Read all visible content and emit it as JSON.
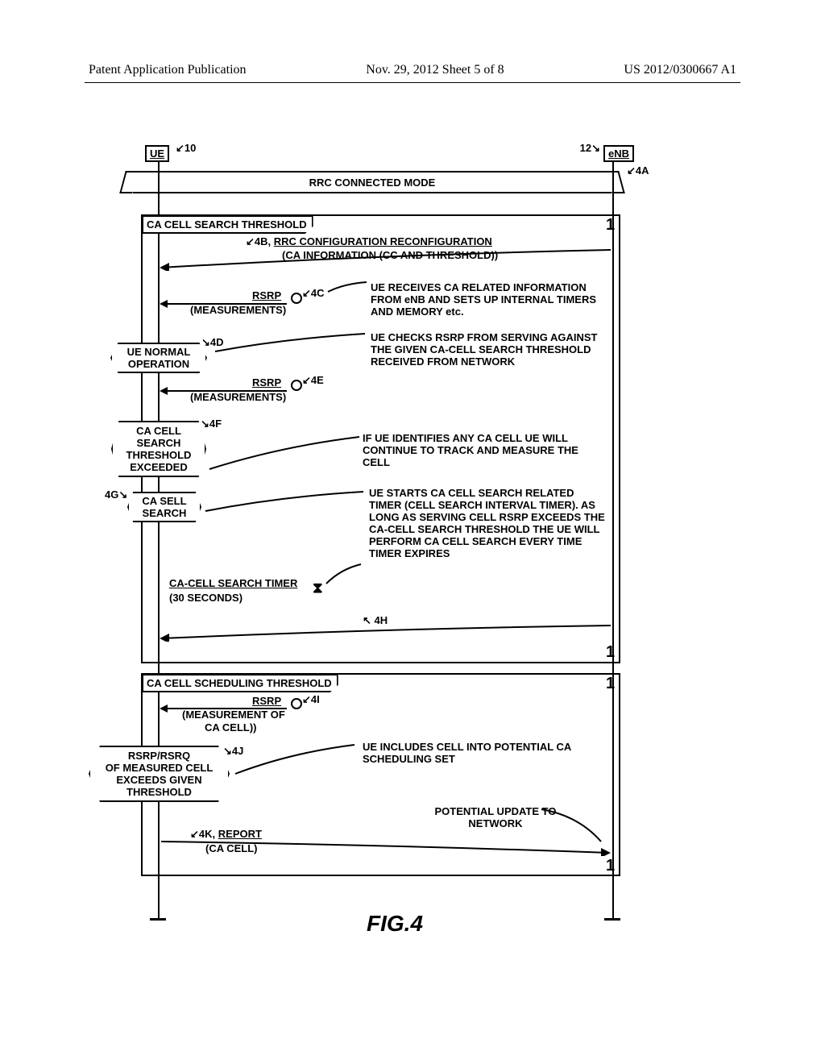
{
  "header": {
    "left": "Patent Application Publication",
    "center": "Nov. 29, 2012 Sheet 5 of 8",
    "right": "US 2012/0300667 A1"
  },
  "figure_label": "FIG.4",
  "actors": {
    "ue": {
      "label": "UE",
      "ref": "10"
    },
    "enb": {
      "label": "eNB",
      "ref": "12"
    }
  },
  "mode_bar": {
    "label": "RRC CONNECTED MODE",
    "ref": "4A"
  },
  "frames": {
    "frame1": {
      "title": "CA CELL SEARCH THRESHOLD"
    },
    "frame2": {
      "title": "CA CELL SCHEDULING THRESHOLD"
    }
  },
  "messages": {
    "m4b": {
      "ref": "4B,",
      "title": "RRC CONFIGURATION RECONFIGURATION",
      "sub": "(CA INFORMATION (CC AND THRESHOLD))"
    },
    "m4c": {
      "ref": "4C",
      "title": "RSRP",
      "sub": "(MEASUREMENTS)"
    },
    "m4e": {
      "ref": "4E",
      "title": "RSRP",
      "sub": "(MEASUREMENTS)"
    },
    "m4i": {
      "ref": "4I",
      "title": "RSRP",
      "sub": "(MEASUREMENT OF",
      "sub2": "CA CELL))"
    },
    "m4k": {
      "ref": "4K,",
      "title": "REPORT",
      "sub": "(CA CELL)"
    },
    "timer": {
      "title": "CA-CELL SEARCH TIMER",
      "sub": "(30 SECONDS)",
      "ref": "4H"
    }
  },
  "hexagons": {
    "h4d": {
      "ref": "4D",
      "line1": "UE NORMAL",
      "line2": "OPERATION"
    },
    "h4f": {
      "ref": "4F",
      "line1": "CA CELL",
      "line2": "SEARCH",
      "line3": "THRESHOLD",
      "line4": "EXCEEDED"
    },
    "h4g": {
      "ref": "4G",
      "line1": "CA SELL",
      "line2": "SEARCH"
    },
    "h4j": {
      "ref": "4J",
      "line1": "RSRP/RSRQ",
      "line2": "OF MEASURED CELL",
      "line3": "EXCEEDS GIVEN",
      "line4": "THRESHOLD"
    }
  },
  "annotations": {
    "a1": "UE RECEIVES CA RELATED INFORMATION FROM eNB AND SETS UP INTERNAL TIMERS AND MEMORY etc.",
    "a2": "UE CHECKS RSRP FROM SERVING AGAINST THE GIVEN CA-CELL SEARCH THRESHOLD RECEIVED FROM NETWORK",
    "a3": "IF UE IDENTIFIES ANY CA CELL UE WILL CONTINUE TO TRACK AND MEASURE THE CELL",
    "a4": "UE STARTS CA CELL SEARCH RELATED TIMER (CELL SEARCH INTERVAL TIMER). AS LONG AS SERVING CELL RSRP EXCEEDS THE CA-CELL SEARCH THRESHOLD THE UE WILL PERFORM CA CELL SEARCH EVERY TIME TIMER EXPIRES",
    "a5": "UE INCLUDES CELL INTO POTENTIAL CA SCHEDULING SET",
    "a6": "POTENTIAL UPDATE TO NETWORK"
  }
}
